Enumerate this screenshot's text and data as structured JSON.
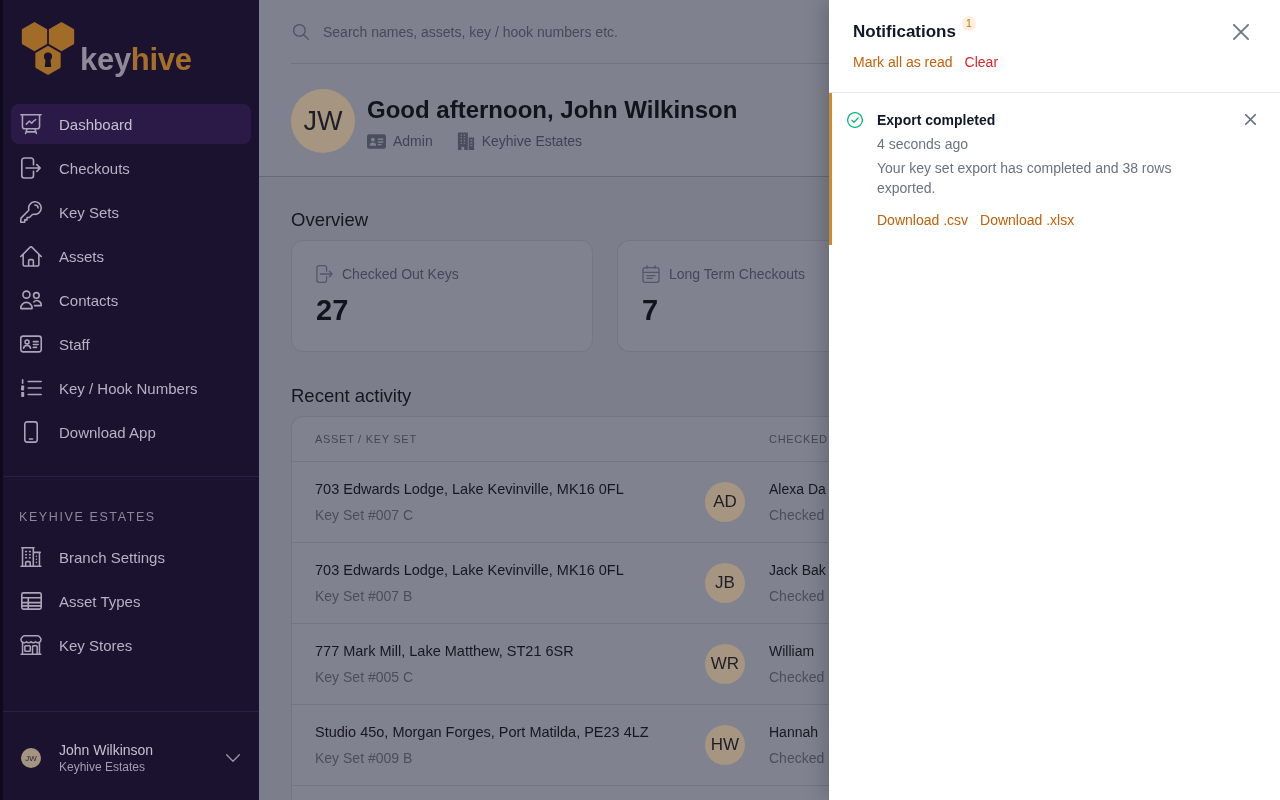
{
  "sidebar": {
    "logo": {
      "text": "key",
      "accent_text": "hive"
    },
    "nav": [
      {
        "label": "Dashboard",
        "selected": true
      },
      {
        "label": "Checkouts",
        "selected": false
      },
      {
        "label": "Key Sets",
        "selected": false
      },
      {
        "label": "Assets",
        "selected": false
      },
      {
        "label": "Contacts",
        "selected": false
      },
      {
        "label": "Staff",
        "selected": false
      },
      {
        "label": "Key / Hook Numbers",
        "selected": false
      },
      {
        "label": "Download App",
        "selected": false
      }
    ],
    "branch_section": {
      "title": "KEYHIVE ESTATES",
      "items": [
        {
          "label": "Branch Settings",
          "selected": false
        },
        {
          "label": "Asset Types",
          "selected": false
        },
        {
          "label": "Key Stores",
          "selected": false
        }
      ]
    },
    "user": {
      "initials": "JW",
      "name": "John Wilkinson",
      "organisation": "Keyhive Estates"
    }
  },
  "main": {
    "search": {
      "placeholder": "Search names, assets, key / hook numbers etc."
    },
    "profile": {
      "initials": "JW",
      "greeting": "Good afternoon, John Wilkinson",
      "role": "Admin",
      "organisation": "Keyhive Estates"
    },
    "overview": {
      "title": "Overview",
      "cards": [
        {
          "label": "Checked Out Keys",
          "value": "27"
        },
        {
          "label": "Long Term Checkouts",
          "value": "7"
        }
      ]
    },
    "recent_activity": {
      "title": "Recent activity",
      "columns": [
        "ASSET / KEY SET",
        "CHECKED"
      ],
      "rows": [
        {
          "asset": "703 Edwards Lodge, Lake Kevinville, MK16 0FL",
          "key_set": "Key Set #007 C",
          "initials": "AD",
          "column_2_top": "Alexa Da",
          "column_2_bottom": "Checked"
        },
        {
          "asset": "703 Edwards Lodge, Lake Kevinville, MK16 0FL",
          "key_set": "Key Set #007 B",
          "initials": "JB",
          "column_2_top": "Jack Bak",
          "column_2_bottom": "Checked"
        },
        {
          "asset": "777 Mark Mill, Lake Matthew, ST21 6SR",
          "key_set": "Key Set #005 C",
          "initials": "WR",
          "column_2_top": "William",
          "column_2_bottom": "Checked"
        },
        {
          "asset": "Studio 45o, Morgan Forges, Port Matilda, PE23 4LZ",
          "key_set": "Key Set #009 B",
          "initials": "HW",
          "column_2_top": "Hannah",
          "column_2_bottom": "Checked"
        }
      ]
    }
  },
  "notifications": {
    "title": "Notifications",
    "unread_count": "1",
    "actions": [
      {
        "label": "Mark all as read",
        "kind": "primary"
      },
      {
        "label": "Clear",
        "kind": "danger"
      }
    ],
    "items": [
      {
        "kind": "success",
        "unread": true,
        "title": "Export completed",
        "time": "4 seconds ago",
        "message": "Your key set export has completed and 38 rows exported.",
        "links": [
          "Download .csv",
          "Download .xlsx"
        ]
      }
    ]
  }
}
